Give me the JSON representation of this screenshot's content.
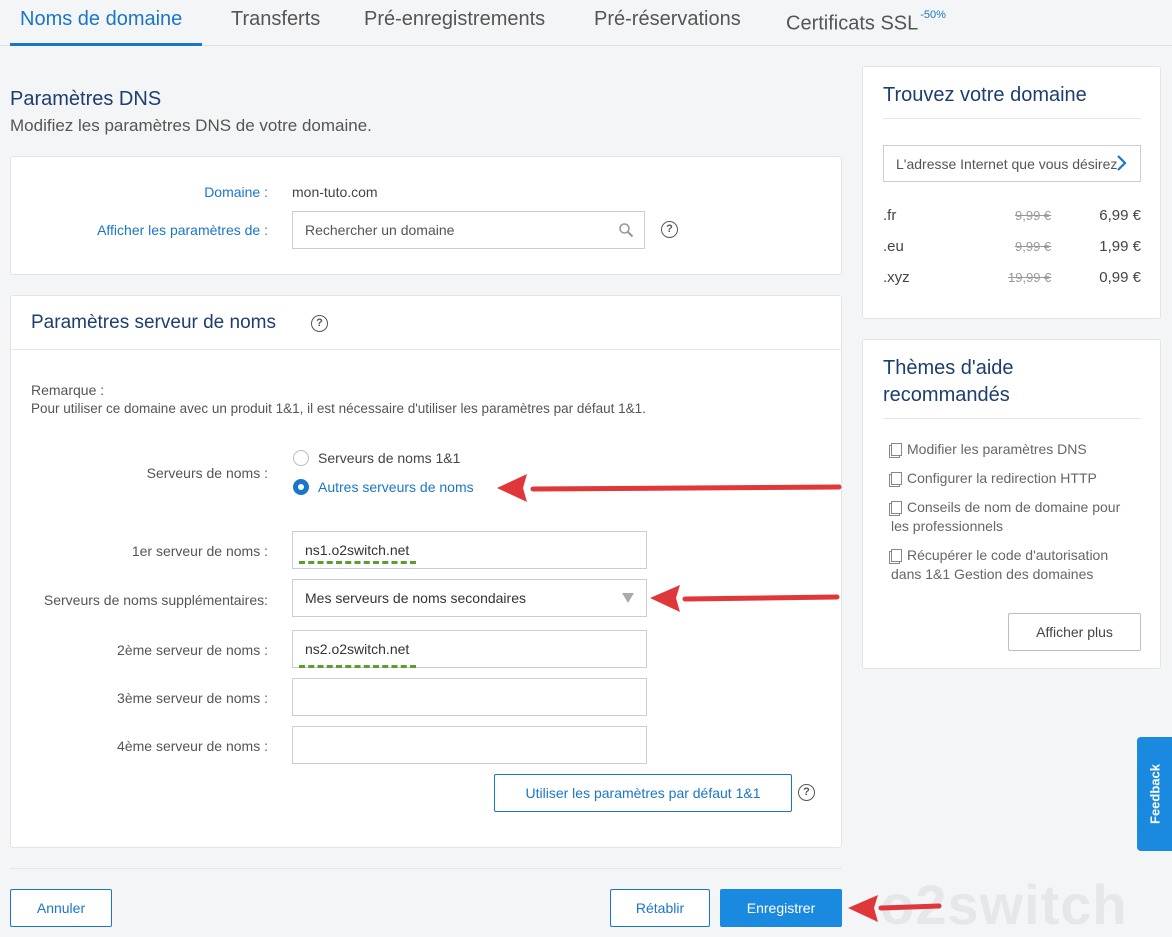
{
  "tabs": [
    {
      "label": "Noms de domaine",
      "active": true
    },
    {
      "label": "Transferts"
    },
    {
      "label": "Pré-enregistrements"
    },
    {
      "label": "Pré-réservations"
    },
    {
      "label": "Certificats SSL",
      "badge": "-50%"
    }
  ],
  "dns": {
    "title": "Paramètres DNS",
    "subtitle": "Modifiez les paramètres DNS de votre domaine.",
    "domain_label": "Domaine :",
    "domain_value": "mon-tuto.com",
    "show_label": "Afficher les paramètres de :",
    "search_placeholder": "Rechercher un domaine"
  },
  "ns": {
    "title": "Paramètres serveur de noms",
    "remark_title": "Remarque :",
    "remark_text": "Pour utiliser ce domaine avec un produit 1&1, il est nécessaire d'utiliser les paramètres par défaut 1&1.",
    "servers_label": "Serveurs de noms :",
    "option_1": "Serveurs de noms 1&1",
    "option_2": "Autres serveurs de noms",
    "ns1_label": "1er serveur de noms :",
    "ns1_value": "ns1.o2switch.net",
    "extra_label": "Serveurs de noms supplémentaires:",
    "extra_value": "Mes serveurs de noms secondaires",
    "ns2_label": "2ème serveur de noms :",
    "ns2_value": "ns2.o2switch.net",
    "ns3_label": "3ème serveur de noms :",
    "ns3_value": "",
    "ns4_label": "4ème serveur de noms :",
    "ns4_value": "",
    "default_button": "Utiliser les paramètres par défaut 1&1"
  },
  "footer": {
    "cancel": "Annuler",
    "reset": "Rétablir",
    "save": "Enregistrer"
  },
  "domain_search": {
    "title": "Trouvez votre domaine",
    "placeholder": "L'adresse Internet que vous désirez",
    "prices": [
      {
        "ext": ".fr",
        "old": "9,99 €",
        "new": "6,99 €"
      },
      {
        "ext": ".eu",
        "old": "9,99 €",
        "new": "1,99 €"
      },
      {
        "ext": ".xyz",
        "old": "19,99 €",
        "new": "0,99 €"
      }
    ]
  },
  "help": {
    "title_line1": "Thèmes d'aide",
    "title_line2": "recommandés",
    "items": [
      "Modifier les paramètres DNS",
      "Configurer la redirection HTTP",
      "Conseils de nom de domaine pour les professionnels",
      "Récupérer le code d'autorisation dans 1&1 Gestion des domaines"
    ],
    "more_button": "Afficher plus"
  },
  "feedback_label": "Feedback",
  "watermark": "o2switch",
  "colors": {
    "accent": "#1a76c9",
    "primary_button": "#1a8ae0",
    "arrow": "#e0383a",
    "dash": "#5a9e2f"
  }
}
